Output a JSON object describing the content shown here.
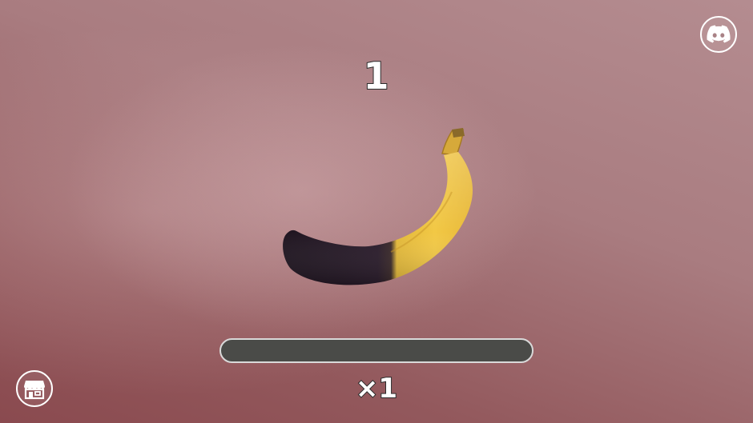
{
  "score": "1",
  "multiplier": "×1",
  "progress": 0,
  "icons": {
    "discord": "discord-icon",
    "shop": "shop-icon",
    "banana": "banana"
  },
  "colors": {
    "background": "#a97c80",
    "progress_track": "#4a4b48",
    "progress_border": "#d9d9d9",
    "text": "#ffffff",
    "text_outline": "#2b2b2b"
  }
}
